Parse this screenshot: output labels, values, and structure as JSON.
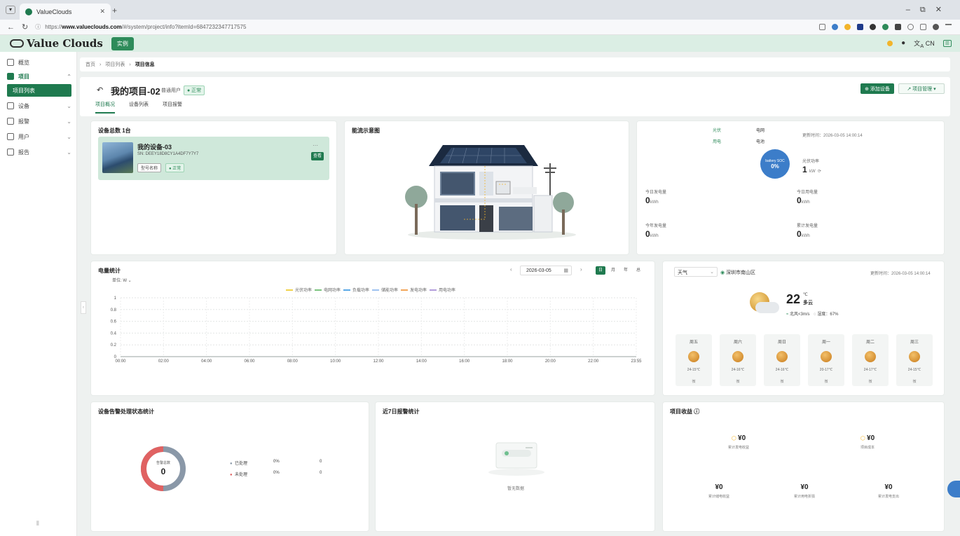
{
  "browser": {
    "tab_title": "ValueClouds",
    "url_prefix": "https://",
    "url_host": "www.valueclouds.com",
    "url_path": "/#/system/project/info?itemId=6847232347717575"
  },
  "app": {
    "logo_text": "Value Clouds",
    "top_tab": "实例",
    "lang": "CN"
  },
  "sidebar": {
    "items": [
      {
        "label": "概览"
      },
      {
        "label": "项目"
      },
      {
        "label": "项目列表"
      },
      {
        "label": "设备"
      },
      {
        "label": "报警"
      },
      {
        "label": "用户"
      },
      {
        "label": "报告"
      }
    ]
  },
  "breadcrumb": [
    "首页",
    "项目列表",
    "项目信息"
  ],
  "page": {
    "title": "我的项目-02",
    "tag": "普通用户",
    "status": "● 正常",
    "add_button": "⊕ 添加设备",
    "manage_button": "↗ 项目管理 ▾",
    "tabs": [
      "项目概况",
      "设备列表",
      "项目报警"
    ]
  },
  "device_card": {
    "title": "设备总数 1台",
    "name": "我的设备-03",
    "sn": "SN: DEEY18D8CY1A4DF7Y7Y7",
    "model": "型号名称",
    "status": "● 正常",
    "button": "查看"
  },
  "topology": {
    "title": "能流示意图"
  },
  "flow": {
    "pv": "光伏",
    "grid": "电网",
    "load": "用电",
    "battery": "电池",
    "updated": "更新时间：2026-03-05 14:00:14",
    "soc_label": "battery SOC",
    "soc_value": "0%",
    "power_label": "光伏功率",
    "power_value": "1",
    "power_unit": "kW",
    "metrics": [
      {
        "label": "今日发电量",
        "value": "0",
        "unit": "kWh"
      },
      {
        "label": "今日用电量",
        "value": "0",
        "unit": "kWh"
      },
      {
        "label": "今年发电量",
        "value": "0",
        "unit": "kWh"
      },
      {
        "label": "累计发电量",
        "value": "0",
        "unit": "kWh"
      }
    ]
  },
  "energy_chart": {
    "title": "电量统计",
    "unit_label": "单位:",
    "unit_value": "W",
    "date": "2026-03-05",
    "granularity": [
      "日",
      "月",
      "年",
      "总"
    ],
    "legend": [
      "光伏功率",
      "电网功率",
      "负载功率",
      "储能功率",
      "发电功率",
      "用电功率"
    ],
    "legend_colors": [
      "#f0d24a",
      "#7bc47f",
      "#5aa9e6",
      "#9ec3f0",
      "#f2a65a",
      "#b39ddb"
    ]
  },
  "chart_data": {
    "type": "line",
    "title": "电量统计",
    "xlabel": "",
    "ylabel": "",
    "x": [
      "00:00",
      "02:00",
      "04:00",
      "06:00",
      "08:00",
      "10:00",
      "12:00",
      "14:00",
      "16:00",
      "18:00",
      "20:00",
      "22:00",
      "23:55"
    ],
    "yticks": [
      "0",
      "0.2",
      "0.4",
      "0.6",
      "0.8",
      "1"
    ],
    "ylim": [
      0,
      1
    ],
    "grid": true,
    "legend_position": "top",
    "series": []
  },
  "weather": {
    "type_select": "天气",
    "location": "深圳市南山区",
    "updated": "更新时间：2026-03-05 14:00:14",
    "temp": "22",
    "temp_unit": "℃",
    "condition": "多云",
    "wind": "北风<3m/s",
    "humidity": "湿度：67%",
    "days": [
      {
        "day": "周五",
        "temp": "24-15℃",
        "wind": "微"
      },
      {
        "day": "周六",
        "temp": "24-16℃",
        "wind": "微"
      },
      {
        "day": "周日",
        "temp": "24-16℃",
        "wind": "微"
      },
      {
        "day": "周一",
        "temp": "20-17℃",
        "wind": "微"
      },
      {
        "day": "周二",
        "temp": "24-17℃",
        "wind": "微"
      },
      {
        "day": "周三",
        "temp": "24-15℃",
        "wind": "微"
      }
    ]
  },
  "alarm_status": {
    "title": "设备告警处理状态统计",
    "center_label": "告警总数",
    "center_value": "0",
    "legend": [
      {
        "label": "已处理",
        "pct": "0%",
        "count": "0",
        "color": "#8a98a8"
      },
      {
        "label": "未处理",
        "pct": "0%",
        "count": "0",
        "color": "#e06262"
      }
    ]
  },
  "alarm_7d": {
    "title": "近7日报警统计",
    "empty": "暂无数据"
  },
  "earnings": {
    "title": "项目收益 ⓘ",
    "items": [
      {
        "value": "¥0",
        "label": "累计发电收益"
      },
      {
        "value": "¥0",
        "label": "项目成本"
      },
      {
        "value": "¥0",
        "label": "累计储电收益"
      },
      {
        "value": "¥0",
        "label": "累计用电折损"
      },
      {
        "value": "¥0",
        "label": "累计发电支出"
      }
    ]
  }
}
